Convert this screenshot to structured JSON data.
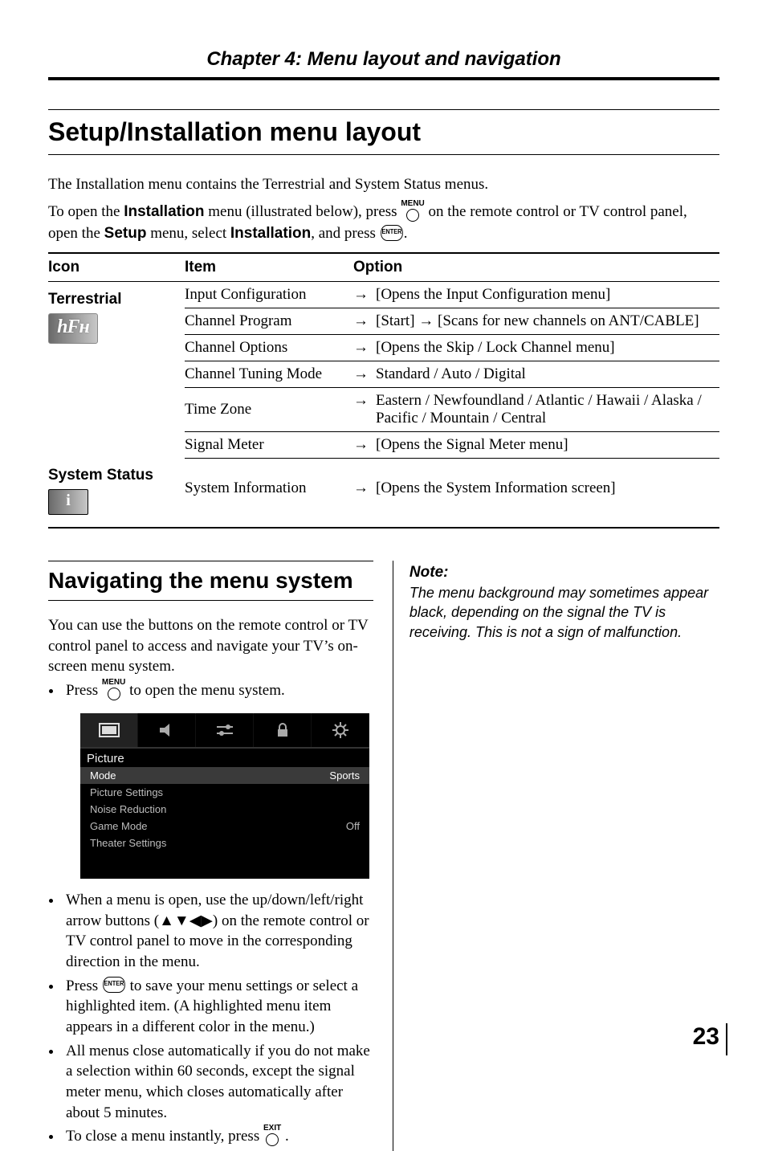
{
  "chapter": "Chapter 4: Menu layout and navigation",
  "heading1": "Setup/Installation menu layout",
  "intro1": "The Installation menu contains the Terrestrial and System Status menus.",
  "intro2_a": "To open the ",
  "intro2_b": "Installation",
  "intro2_c": " menu (illustrated below), press ",
  "intro2_d": " on the remote control or TV control panel, open the ",
  "intro2_e": "Setup",
  "intro2_f": " menu, select ",
  "intro2_g": "Installation",
  "intro2_h": ", and press ",
  "btn_menu": "MENU",
  "btn_exit": "EXIT",
  "btn_enter": "ENTER",
  "table": {
    "head": {
      "icon": "Icon",
      "item": "Item",
      "option": "Option"
    },
    "sections": [
      {
        "label": "Terrestrial",
        "iconGlyph": "hₘ",
        "rows": [
          {
            "item": "Input Configuration",
            "arrow": "→",
            "option": "[Opens the Input Configuration menu]"
          },
          {
            "item": "Channel Program",
            "arrow": "→",
            "option": "[Start] → [Scans for new channels on ANT/CABLE]"
          },
          {
            "item": "Channel Options",
            "arrow": "→",
            "option": "[Opens the Skip / Lock Channel menu]"
          },
          {
            "item": "Channel Tuning Mode",
            "arrow": "→",
            "option": "Standard / Auto / Digital"
          },
          {
            "item": "Time Zone",
            "arrow": "→",
            "option": "Eastern / Newfoundland / Atlantic / Hawaii / Alaska / Pacific / Mountain / Central"
          },
          {
            "item": "Signal Meter",
            "arrow": "→",
            "option": "[Opens the Signal Meter menu]"
          }
        ]
      },
      {
        "label": "System Status",
        "rows": [
          {
            "item": "System Information",
            "arrow": "→",
            "option": "[Opens the System Information screen]"
          }
        ]
      }
    ]
  },
  "heading2": "Navigating the menu system",
  "nav_intro": "You can use the buttons on the remote control or TV control panel to access and navigate your TV’s on-screen menu system.",
  "bullets": {
    "a1": "Press ",
    "a2": " to open the menu system.",
    "b": "When a menu is open, use the up/down/left/right arrow buttons (▲▼◀▶) on the remote control or TV control panel to move in the corresponding direction in the menu.",
    "c1": "Press ",
    "c2": " to save your menu settings or select a highlighted item. (A highlighted menu item appears in a different color in the menu.)",
    "d": "All menus close automatically if you do not make a selection within 60 seconds, except the signal meter menu, which closes automatically after about 5 minutes.",
    "e1": "To close a menu instantly, press ",
    "e2": "."
  },
  "menuMock": {
    "sectionTitle": "Picture",
    "rows": [
      {
        "label": "Mode",
        "value": "Sports",
        "highlight": true
      },
      {
        "label": "Picture Settings",
        "value": ""
      },
      {
        "label": "Noise Reduction",
        "value": ""
      },
      {
        "label": "Game Mode",
        "value": "Off"
      },
      {
        "label": "Theater Settings",
        "value": ""
      }
    ]
  },
  "note": {
    "head": "Note:",
    "body": "The menu background may sometimes appear black, depending on the signal the TV is receiving. This is not a sign of malfunction."
  },
  "pageNumber": "23"
}
